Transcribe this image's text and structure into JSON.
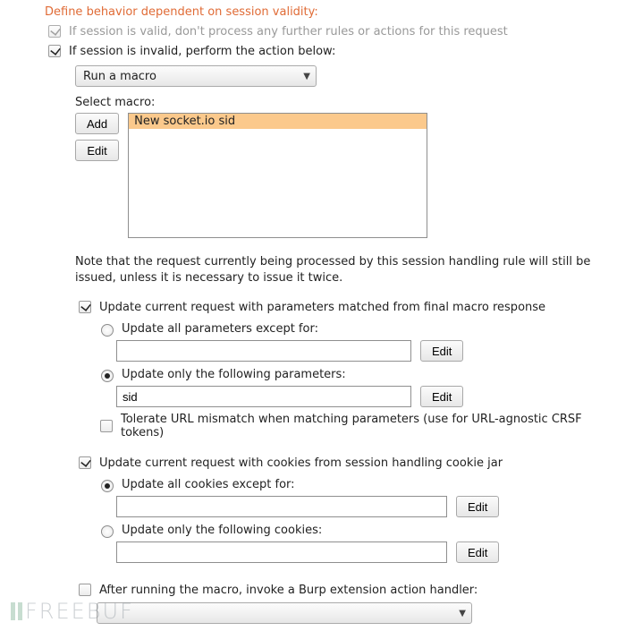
{
  "heading": "Define behavior dependent on session validity:",
  "checkbox_valid": {
    "label": "If session is valid, don't process any further rules or actions for this request",
    "checked": true,
    "disabled": true
  },
  "checkbox_invalid": {
    "label": "If session is invalid, perform the action below:",
    "checked": true
  },
  "action_combo": "Run a macro",
  "select_macro_label": "Select macro:",
  "btn_add": "Add",
  "btn_edit": "Edit",
  "macro_items": [
    {
      "label": "New socket.io sid",
      "selected": true
    }
  ],
  "note_text": "Note that the request currently being processed by this session handling rule will still be issued, unless it is necessary to issue it twice.",
  "update_params": {
    "label": "Update current request with parameters matched from final macro response",
    "checked": true,
    "mode_except": "Update all parameters except for:",
    "mode_only": "Update only the following parameters:",
    "except_value": "",
    "only_value": "sid",
    "btn_edit": "Edit",
    "tolerate": {
      "label": "Tolerate URL mismatch when matching parameters (use for URL-agnostic CRSF tokens)",
      "checked": false
    }
  },
  "update_cookies": {
    "label": "Update current request with cookies from session handling cookie jar",
    "checked": true,
    "mode_except": "Update all cookies except for:",
    "mode_only": "Update only the following cookies:",
    "except_value": "",
    "only_value": "",
    "btn_edit": "Edit"
  },
  "after_macro": {
    "label": "After running the macro, invoke a Burp extension action handler:",
    "checked": false,
    "combo_value": ""
  },
  "watermark": "FREEBUF"
}
